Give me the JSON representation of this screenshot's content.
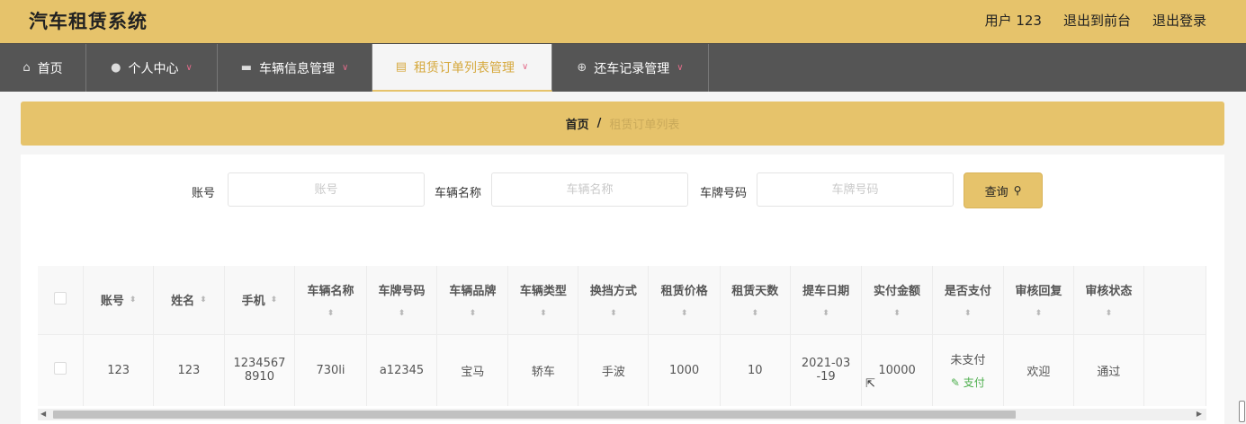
{
  "header": {
    "title": "汽车租赁系统",
    "user_label": "用户 123",
    "front_link": "退出到前台",
    "logout_link": "退出登录",
    "bg_color": "#e6c36b"
  },
  "nav": {
    "items": [
      {
        "label": "首页",
        "icon": "home-icon"
      },
      {
        "label": "个人中心",
        "icon": "user-icon"
      },
      {
        "label": "车辆信息管理",
        "icon": "briefcase-icon"
      },
      {
        "label": "租赁订单列表管理",
        "icon": "clipboard-icon"
      },
      {
        "label": "还车记录管理",
        "icon": "compass-icon"
      }
    ],
    "active": "租赁订单列表管理",
    "bg_color": "#555555"
  },
  "breadcrumb": {
    "home": "首页",
    "separator": "/",
    "current": "租赁订单列表"
  },
  "search": {
    "account_label": "账号",
    "account_placeholder": "账号",
    "vehicle_name_label": "车辆名称",
    "vehicle_name_placeholder": "车辆名称",
    "plate_label": "车牌号码",
    "plate_placeholder": "车牌号码",
    "query_button": "查询",
    "query_icon": "search-icon"
  },
  "table": {
    "columns": [
      "账号",
      "姓名",
      "手机",
      "车辆名称",
      "车牌号码",
      "车辆品牌",
      "车辆类型",
      "换挡方式",
      "租赁价格",
      "租赁天数",
      "提车日期",
      "实付金额",
      "是否支付",
      "审核回复",
      "审核状态"
    ],
    "sort_icon": "⬍",
    "rows": [
      {
        "account": "123",
        "name": "123",
        "phone_line1": "1234567",
        "phone_line2": "8910",
        "vehicle_name": "730li",
        "plate": "a12345",
        "brand": "宝马",
        "type": "轿车",
        "gear": "手波",
        "price": "1000",
        "days": "10",
        "date_line1": "2021-03",
        "date_line2": "-19",
        "paid_amount": "10000",
        "pay_status": "未支付",
        "pay_action": "支付",
        "review_reply": "欢迎",
        "review_status": "通过"
      }
    ]
  }
}
